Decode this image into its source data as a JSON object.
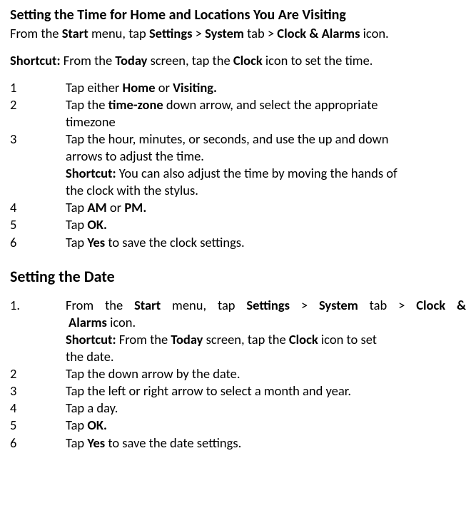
{
  "section1": {
    "title": "Setting the Time for Home and Locations You Are Visiting",
    "intro_pre": "From the ",
    "intro_b1": "Start",
    "intro_mid1": " menu, tap ",
    "intro_b2": "Settings",
    "intro_mid2": " > ",
    "intro_b3": "System ",
    "intro_mid3": "tab > ",
    "intro_b4": "Clock & Alarms",
    "intro_post": " icon.",
    "shortcut_label": "Shortcut:",
    "shortcut_pre": " From the ",
    "shortcut_b1": "Today",
    "shortcut_mid": " screen, tap the ",
    "shortcut_b2": "Clock",
    "shortcut_post": " icon to set the time.",
    "step1_num": "1",
    "step1_pre": "Tap either ",
    "step1_b1": "Home",
    "step1_mid": " or ",
    "step1_b2": "Visiting.",
    "step2_num": "2",
    "step2_pre": "Tap the ",
    "step2_b1": "time-zone",
    "step2_line1_post": " down arrow, and select the appropriate",
    "step2_line2": "timezone",
    "step3_num": "3",
    "step3_line1": "Tap the hour, minutes, or seconds, and use the up and down",
    "step3_line2": "arrows to adjust the time.",
    "step3_sc_label": "Shortcut:",
    "step3_sc_line1_post": " You can also adjust the time by moving the hands of",
    "step3_sc_line2": "the clock with the stylus.",
    "step4_num": "4",
    "step4_pre": "Tap ",
    "step4_b1": "AM",
    "step4_mid": " or ",
    "step4_b2": "PM.",
    "step5_num": "5",
    "step5_pre": "Tap ",
    "step5_b1": "OK.",
    "step6_num": "6",
    "step6_pre": "Tap ",
    "step6_b1": "Yes",
    "step6_post": " to save the clock settings."
  },
  "section2": {
    "title": "Setting the Date",
    "step1_num": "1.",
    "step1_w1": "From",
    "step1_w2": "the",
    "step1_b1": "Start",
    "step1_w3": "menu,",
    "step1_w4": "tap",
    "step1_b2": "Settings",
    "step1_w5": ">",
    "step1_b3": "System",
    "step1_w6": "tab",
    "step1_w7": ">",
    "step1_b4": "Clock &",
    "step1_line2_b": "Alarms",
    "step1_line2_post": " icon.",
    "sc_label": "Shortcut:",
    "sc_pre": " From the ",
    "sc_b1": "Today",
    "sc_mid": " screen, tap the ",
    "sc_b2": "Clock",
    "sc_post": " icon to set",
    "sc_line2": " the date.",
    "step2_num": "2",
    "step2_text": "Tap the down arrow by the date.",
    "step3_num": "3",
    "step3_text": "Tap the left or right arrow to select a month and year.",
    "step4_num": "4",
    "step4_text": "Tap a day.",
    "step5_num": "5",
    "step5_pre": "Tap ",
    "step5_b1": "OK.",
    "step6_num": "6",
    "step6_pre": "Tap ",
    "step6_b1": "Yes",
    "step6_post": " to save the date settings."
  }
}
